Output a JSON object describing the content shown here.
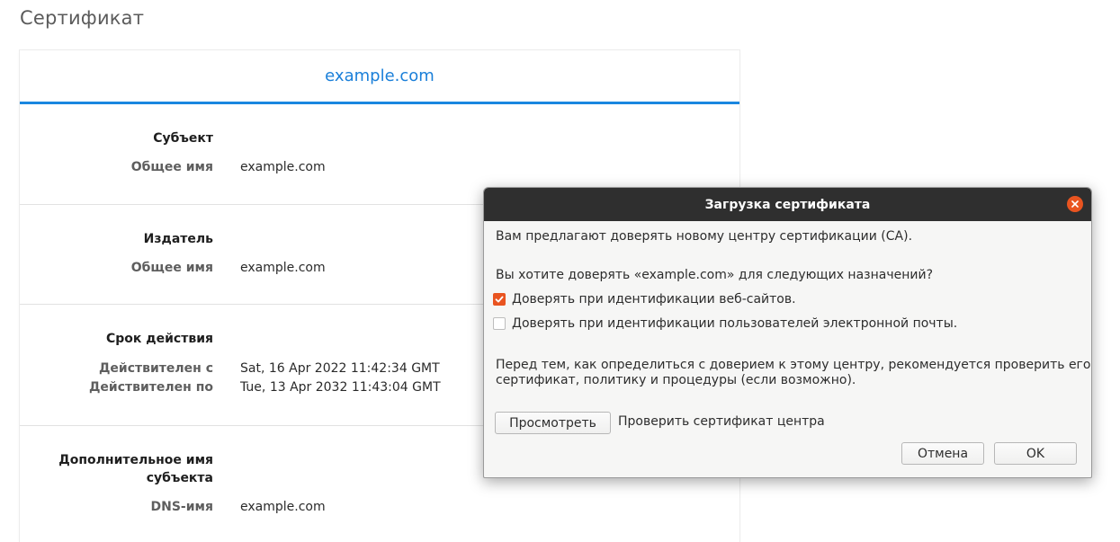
{
  "page": {
    "title": "Сертификат"
  },
  "certificate": {
    "header": "example.com",
    "sections": [
      {
        "title": "Субъект",
        "rows": [
          {
            "label": "Общее имя",
            "value": "example.com"
          }
        ]
      },
      {
        "title": "Издатель",
        "rows": [
          {
            "label": "Общее имя",
            "value": "example.com"
          }
        ]
      },
      {
        "title": "Срок действия",
        "rows": [
          {
            "label": "Действителен с",
            "value": "Sat, 16 Apr 2022 11:42:34 GMT"
          },
          {
            "label": "Действителен по",
            "value": "Tue, 13 Apr 2032 11:43:04 GMT"
          }
        ]
      },
      {
        "title_line1": "Дополнительное имя",
        "title_line2": "субъекта",
        "rows": [
          {
            "label": "DNS-имя",
            "value": "example.com"
          }
        ]
      }
    ]
  },
  "dialog": {
    "title": "Загрузка сертификата",
    "intro": "Вам предлагают доверять новому центру сертификации (CA).",
    "question": "Вы хотите доверять «example.com» для следующих назначений?",
    "checkboxes": [
      {
        "label": "Доверять при идентификации веб-сайтов.",
        "checked": true
      },
      {
        "label": "Доверять при идентификации пользователей электронной почты.",
        "checked": false
      }
    ],
    "advice_line1": "Перед тем, как определиться с доверием к этому центру, рекомендуется проверить его",
    "advice_line2": "сертификат, политику и процедуры (если возможно).",
    "view_button": "Просмотреть",
    "view_hint": "Проверить сертификат центра",
    "cancel_button": "Отмена",
    "ok_button": "OK"
  },
  "colors": {
    "accent": "#e95420",
    "link": "#1a7fd9",
    "titlebar": "#2f2f2f"
  }
}
